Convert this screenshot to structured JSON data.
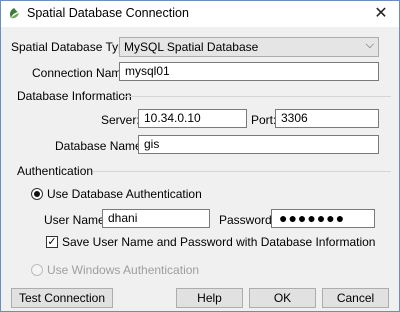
{
  "window": {
    "title": "Spatial Database Connection",
    "close_symbol": "✕"
  },
  "form": {
    "db_type_label": "Spatial Database Type:",
    "db_type_value": "MySQL Spatial Database",
    "connection_name_label": "Connection Name:",
    "connection_name_value": "mysql01"
  },
  "db_info": {
    "heading": "Database Information",
    "server_label": "Server:",
    "server_value": "10.34.0.10",
    "port_label": "Port:",
    "port_value": "3306",
    "dbname_label": "Database Name:",
    "dbname_value": "gis"
  },
  "auth": {
    "heading": "Authentication",
    "use_db_auth_label": "Use Database Authentication",
    "use_db_auth_selected": true,
    "username_label": "User Name:",
    "username_value": "dhani",
    "password_label": "Password:",
    "password_masked": "●●●●●●●",
    "save_checkbox_label": "Save User Name and Password with Database Information",
    "save_checked": true,
    "windows_auth_label": "Use Windows Authentication",
    "windows_auth_enabled": false
  },
  "buttons": {
    "test": "Test Connection",
    "help": "Help",
    "ok": "OK",
    "cancel": "Cancel"
  },
  "icons": {
    "app": "app-logo-icon",
    "close": "close-icon",
    "dropdown": "chevron-down-icon",
    "check": "check-icon"
  },
  "colors": {
    "window_border": "#6a8fbf",
    "dialog_bg": "#f0f0f0"
  }
}
